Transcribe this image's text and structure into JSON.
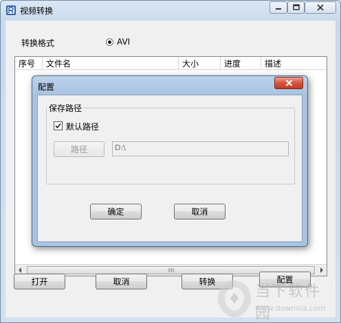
{
  "window": {
    "title": "视频转换",
    "app_icon": "video-app-icon",
    "controls": [
      "minimize-icon",
      "maximize-icon",
      "close-icon"
    ]
  },
  "main": {
    "format_label": "转换格式",
    "format_option": "AVI",
    "columns": [
      "序号",
      "文件名",
      "大小",
      "进度",
      "描述"
    ],
    "buttons": {
      "open": "打开",
      "cancel": "取消",
      "convert": "转换",
      "config": "配置"
    }
  },
  "dialog": {
    "title": "配置",
    "group_title": "保存路径",
    "default_path_label": "默认路径",
    "default_path_checked": true,
    "path_button": "路径",
    "path_value": "D:\\",
    "ok_button": "确定",
    "cancel_button": "取消"
  },
  "watermark": {
    "name": "当下软件园",
    "url": "www.downxia.com"
  },
  "colors": {
    "title_gradient_top": "#dce7f4",
    "dialog_frame": "#a9c4e2",
    "close_red": "#c53a23"
  }
}
